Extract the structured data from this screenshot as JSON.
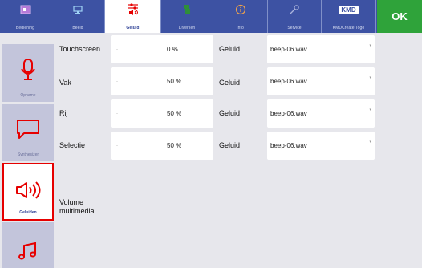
{
  "tabs": [
    {
      "label": "Bediening",
      "icon": "keyboard-square-icon"
    },
    {
      "label": "Beeld",
      "icon": "monitor-icon"
    },
    {
      "label": "Geluid",
      "icon": "sliders-speaker-icon",
      "active": true
    },
    {
      "label": "Diversen",
      "icon": "various-icon"
    },
    {
      "label": "Info",
      "icon": "info-icon"
    },
    {
      "label": "Service",
      "icon": "wrench-icon"
    },
    {
      "label": "KMDCreate Togo",
      "logo": "KMD"
    }
  ],
  "ok_label": "OK",
  "sidebar": [
    {
      "label": "Opname",
      "icon": "microphone-icon"
    },
    {
      "label": "Synthesizer",
      "icon": "speech-bubble-icon"
    },
    {
      "label": "Geluiden",
      "icon": "speaker-sound-icon",
      "active": true
    },
    {
      "label": "",
      "icon": "music-notes-icon"
    }
  ],
  "rows": [
    {
      "label": "Touchscreen",
      "minus": "-",
      "value": "0 %",
      "sound_label": "Geluid",
      "sound": "beep-06.wav"
    },
    {
      "label": "Vak",
      "minus": "-",
      "value": "50 %",
      "sound_label": "Geluid",
      "sound": "beep-06.wav"
    },
    {
      "label": "Rij",
      "minus": "-",
      "value": "50 %",
      "sound_label": "Geluid",
      "sound": "beep-06.wav"
    },
    {
      "label": "Selectie",
      "minus": "-",
      "value": "50 %",
      "sound_label": "Geluid",
      "sound": "beep-06.wav"
    }
  ],
  "multimedia_label": "Volume multimedia",
  "colors": {
    "topbar": "#3d52a3",
    "active_border": "#e60000",
    "ok": "#2fa33a",
    "sidebar_item": "#c3c5db"
  }
}
